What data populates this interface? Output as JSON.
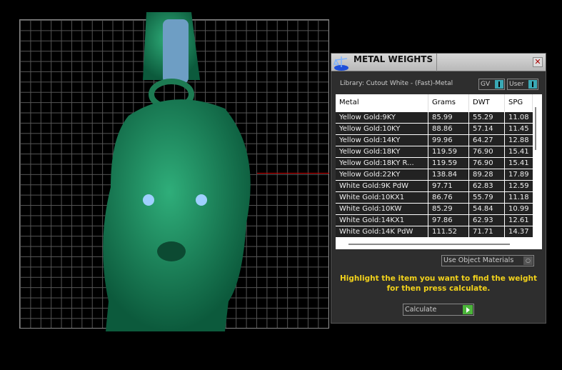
{
  "panel": {
    "title": "METAL WEIGHTS",
    "library": "Library: Cutout White - (Fast)-Metal",
    "toggles": [
      {
        "label": "GV"
      },
      {
        "label": "User"
      }
    ],
    "columns": [
      "Metal",
      "Grams",
      "DWT",
      "SPG"
    ],
    "rows": [
      [
        "Yellow Gold:9KY",
        "85.99",
        "55.29",
        "11.08"
      ],
      [
        "Yellow Gold:10KY",
        "88.86",
        "57.14",
        "11.45"
      ],
      [
        "Yellow Gold:14KY",
        "99.96",
        "64.27",
        "12.88"
      ],
      [
        "Yellow Gold:18KY",
        "119.59",
        "76.90",
        "15.41"
      ],
      [
        "Yellow Gold:18KY R...",
        "119.59",
        "76.90",
        "15.41"
      ],
      [
        "Yellow Gold:22KY",
        "138.84",
        "89.28",
        "17.89"
      ],
      [
        "White Gold:9K PdW",
        "97.71",
        "62.83",
        "12.59"
      ],
      [
        "White Gold:10KX1",
        "86.76",
        "55.79",
        "11.18"
      ],
      [
        "White Gold:10KW",
        "85.29",
        "54.84",
        "10.99"
      ],
      [
        "White Gold:14KX1",
        "97.86",
        "62.93",
        "12.61"
      ],
      [
        "White Gold:14K PdW",
        "111.52",
        "71.71",
        "14.37"
      ]
    ],
    "use_object_materials": "Use Object Materials",
    "message_line1": "Highlight the item you want to find the weight",
    "message_line2": "for then press calculate.",
    "calculate": "Calculate"
  },
  "colors": {
    "model": "#1a8a5e",
    "message": "#f2d21b",
    "toggle": "#3aa9b5",
    "calc": "#4bb53a"
  }
}
